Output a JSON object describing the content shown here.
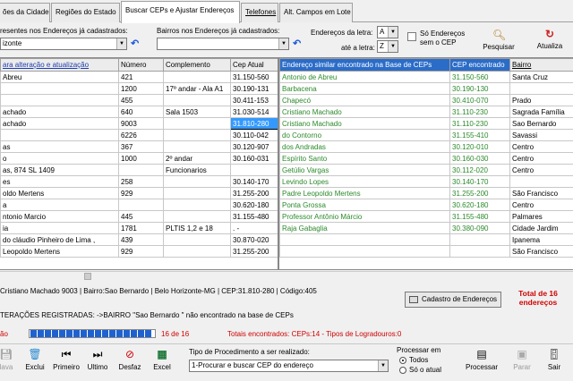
{
  "tabs": [
    {
      "label": "ões da Cidade"
    },
    {
      "label": "Regiões do Estado"
    },
    {
      "label": "Buscar CEPs e Ajustar Endereços"
    },
    {
      "label": "Telefones"
    },
    {
      "label": "Alt. Campos em Lote"
    }
  ],
  "filter": {
    "bairros_label_left": "resentes nos Endereços já cadastrados:",
    "bairros_value_left": "izonte",
    "bairros_label_right": "Bairros nos Endereços já cadastrados:",
    "bairros_value_right": "",
    "letra_de_label": "Endereços da letra:",
    "letra_de_value": "A",
    "letra_ate_label": "até a letra:",
    "letra_ate_value": "Z",
    "so_enderecos_label_1": "Só Endereços",
    "so_enderecos_label_2": "sem o CEP",
    "pesquisar_label": "Pesquisar",
    "atualiza_label": "Atualiza"
  },
  "left_grid": {
    "headers": [
      "ara alteração e atualização",
      "Número",
      "Complemento",
      "Cep Atual"
    ],
    "rows": [
      [
        "Abreu",
        "421",
        "",
        "31.150-560"
      ],
      [
        "",
        "1200",
        "17º andar - Ala A1",
        "30.190-131"
      ],
      [
        "",
        "455",
        "",
        "30.411-153"
      ],
      [
        "achado",
        "640",
        "Sala 1503",
        "31.030-514"
      ],
      [
        "achado",
        "9003",
        "",
        "31.810-280"
      ],
      [
        "",
        "6226",
        "",
        "30.110-042"
      ],
      [
        "as",
        "367",
        "",
        "30.120-907"
      ],
      [
        "o",
        "1000",
        "2º andar",
        "30.160-031"
      ],
      [
        "as, 874 SL 1409",
        "",
        "Funcionarios",
        ""
      ],
      [
        "es",
        "258",
        "",
        "30.140-170"
      ],
      [
        "oldo Mertens",
        "929",
        "",
        "31.255-200"
      ],
      [
        "a",
        "",
        "",
        "30.620-180"
      ],
      [
        "ntonio Marcio",
        "445",
        "",
        "31.155-480"
      ],
      [
        "ia",
        "1781",
        "PLTIS 1,2 e 18",
        " .   - "
      ],
      [
        "do cláudio Pinheiro de Lima ,",
        "439",
        "",
        "30.870-020"
      ],
      [
        "Leopoldo Mertens",
        "929",
        "",
        "31.255-200"
      ]
    ]
  },
  "right_grid": {
    "headers": [
      "Endereço similar encontrado na Base de CEPs",
      "CEP encontrado",
      "Bairro"
    ],
    "rows": [
      [
        "Antonio de Abreu",
        "31.150-560",
        "Santa Cruz"
      ],
      [
        "Barbacena",
        "30.190-130",
        ""
      ],
      [
        "Chapecó",
        "30.410-070",
        "Prado"
      ],
      [
        "Cristiano Machado",
        "31.110-230",
        "Sagrada Família"
      ],
      [
        "Cristiano Machado",
        "31.110-230",
        "Sao Bernardo"
      ],
      [
        "do Contorno",
        "31.155-410",
        "Savassi"
      ],
      [
        "dos Andradas",
        "30.120-010",
        "Centro"
      ],
      [
        "Espírito Santo",
        "30.160-030",
        "Centro"
      ],
      [
        "Getúlio Vargas",
        "30.112-020",
        "Centro"
      ],
      [
        "Levindo Lopes",
        "30.140-170",
        ""
      ],
      [
        "Padre Leopoldo Mertens",
        "31.255-200",
        "São Francisco"
      ],
      [
        "Ponta Grossa",
        "30.620-180",
        "Centro"
      ],
      [
        "Professor Antônio Márcio",
        "31.155-480",
        "Palmares"
      ],
      [
        "Raja Gabaglia",
        "30.380-090",
        "Cidade Jardim"
      ],
      [
        "",
        "",
        "Ipanema"
      ],
      [
        "",
        "",
        "São Francisco"
      ]
    ]
  },
  "selected_info": " Cristiano Machado  9003  | Bairro:Sao Bernardo  | Belo Horizonte-MG | CEP:31.810-280 | Código:405",
  "cadastro_button": "Cadastro de Endereços",
  "total_line1": "Total de 16",
  "total_line2": "endereços",
  "alteracoes_text": "TERAÇÕES REGISTRADAS:  ->BAIRRO \"Sao Bernardo \" não encontrado na base de CEPs",
  "progress": {
    "label": "ão",
    "fraction": 1.0,
    "count_text": "16 de 16",
    "totais_text": "Totais encontrados: CEPs:14 - Tipos de Logradouros:0"
  },
  "toolbar": {
    "salva": "lava",
    "exclui": "Exclui",
    "primeiro": "Primeiro",
    "ultimo": "Ultimo",
    "desfaz": "Desfaz",
    "excel": "Excel",
    "tipo_label": "Tipo de Procedimento a ser realizado:",
    "tipo_value": "1-Procurar e buscar CEP do endereço",
    "processar_em_label": "Processar em",
    "todos_label": "Todos",
    "so_atual_label": "Só o atual",
    "processar": "Processar",
    "parar": "Parar",
    "sair": "Sair"
  },
  "colors": {
    "green_text": "#2b8a2b",
    "selection_blue": "#3399ff",
    "header_blue": "#2b6cc8",
    "total_red": "#d00000",
    "progress_blue": "#1e62d0"
  }
}
